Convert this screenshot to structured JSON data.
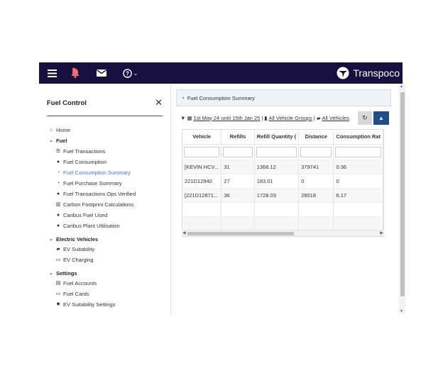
{
  "brand": {
    "name": "Transpoco"
  },
  "topbar": {
    "icons": [
      "menu-icon",
      "bell-icon",
      "mail-icon",
      "help-icon",
      "chevron-down-icon"
    ]
  },
  "sidebar": {
    "title": "Fuel Control",
    "close": "✕",
    "items": [
      {
        "label": "Home",
        "icon": "home-icon"
      },
      {
        "label": "Fuel",
        "icon": "chevron-down-icon"
      },
      {
        "label": "Fuel Transactions",
        "icon": "list-icon"
      },
      {
        "label": "Fuel Consumption",
        "icon": "drop-icon"
      },
      {
        "label": "Fuel Consumption Summary",
        "icon": "dashboard-icon"
      },
      {
        "label": "Fuel Purchase Summary",
        "icon": "dashboard-icon"
      },
      {
        "label": "Fuel Transactions Ops Verified",
        "icon": "drop-icon"
      },
      {
        "label": "Carbon Footprint Calculations",
        "icon": "bar-chart-icon"
      },
      {
        "label": "Canbus Fuel Used",
        "icon": "drop-icon"
      },
      {
        "label": "Canbus Plant Utilisation",
        "icon": "drop-icon"
      },
      {
        "label": "Electric Vehicles",
        "icon": "chevron-down-icon"
      },
      {
        "label": "EV Suitability",
        "icon": "car-icon"
      },
      {
        "label": "EV Charging",
        "icon": "plug-icon"
      },
      {
        "label": "Settings",
        "icon": "chevron-down-icon"
      },
      {
        "label": "Fuel Accounts",
        "icon": "account-icon"
      },
      {
        "label": "Fuel Cards",
        "icon": "card-icon"
      },
      {
        "label": "EV Suitability Settings",
        "icon": "gear-icon"
      }
    ]
  },
  "panel": {
    "title": "Fuel Consumption Summary",
    "filter": {
      "date_range": "1st May 24 until 15th Jan 25",
      "separator": "|",
      "groups": "All Vehicle Groups",
      "vehicles": "All Vehicles"
    }
  },
  "table": {
    "columns": [
      "Vehicle",
      "Refills",
      "Refill Quantity (",
      "Distance",
      "Consumption Rat"
    ],
    "rows": [
      [
        "[KEVIN HCV...",
        "31",
        "1366.12",
        "379741",
        "0.36"
      ],
      [
        "221D12940",
        "27",
        "183.01",
        "0",
        "0"
      ],
      [
        "[221D12871...",
        "36",
        "1728.03",
        "28018",
        "6.17"
      ]
    ]
  },
  "colors": {
    "topbar": "#17103f",
    "active_link": "#3a7bd5",
    "export_button": "#1d4e89",
    "bell": "#e8716d"
  }
}
